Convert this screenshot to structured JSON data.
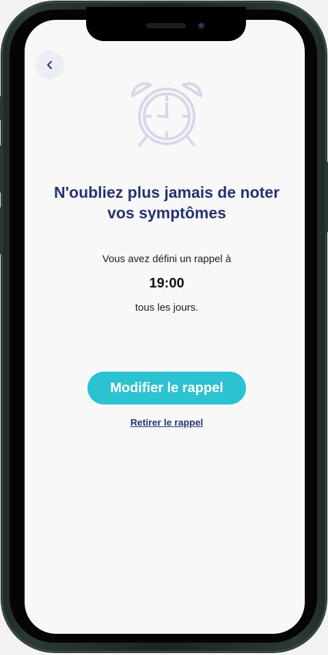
{
  "header": {
    "back_icon": "chevron-left-icon"
  },
  "illustration": {
    "icon": "alarm-clock-icon",
    "color": "#d6d7e8"
  },
  "content": {
    "title_line1": "N'oubliez plus jamais de noter",
    "title_line2": "vos symptômes",
    "reminder_intro": "Vous avez défini un rappel à",
    "reminder_time": "19:00",
    "reminder_frequency": "tous les jours."
  },
  "actions": {
    "modify_label": "Modifier le rappel",
    "remove_label": "Retirer le rappel"
  },
  "colors": {
    "accent": "#2bc2d2",
    "title": "#25336f",
    "background": "#f8f8f9"
  }
}
